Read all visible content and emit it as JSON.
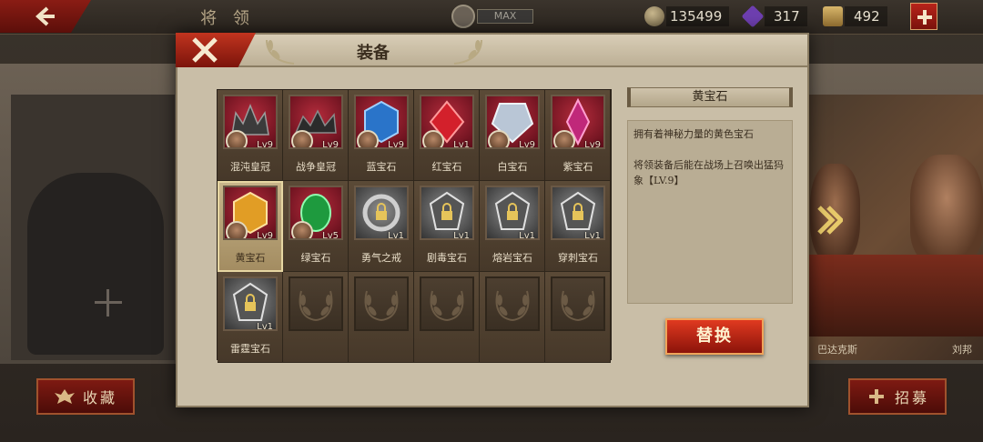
{
  "topbar": {
    "title": "将 领",
    "max_label": "MAX",
    "resources": [
      {
        "icon": "coin-icon",
        "value": "135499"
      },
      {
        "icon": "purple-gem-icon",
        "value": "317"
      },
      {
        "icon": "scroll-icon",
        "value": "492"
      }
    ]
  },
  "background": {
    "hero_names": [
      "巴达克斯",
      "刘邦"
    ],
    "collect_label": "收藏",
    "recruit_label": "招募"
  },
  "modal": {
    "title": "装备",
    "items": [
      {
        "name": "混沌皇冠",
        "level": "Lv9",
        "style": "red",
        "art": "crown-dark-icon",
        "avatar": true
      },
      {
        "name": "战争皇冠",
        "level": "Lv9",
        "style": "red",
        "art": "crown-war-icon",
        "avatar": true
      },
      {
        "name": "蓝宝石",
        "level": "Lv9",
        "style": "red",
        "art": "sapphire-icon",
        "avatar": true
      },
      {
        "name": "红宝石",
        "level": "Lv1",
        "style": "red",
        "art": "ruby-icon",
        "avatar": true
      },
      {
        "name": "白宝石",
        "level": "Lv9",
        "style": "red",
        "art": "diamond-icon",
        "avatar": true
      },
      {
        "name": "紫宝石",
        "level": "Lv9",
        "style": "red",
        "art": "amethyst-icon",
        "avatar": true
      },
      {
        "name": "黄宝石",
        "level": "Lv9",
        "style": "red",
        "art": "topaz-icon",
        "avatar": true,
        "selected": true
      },
      {
        "name": "绿宝石",
        "level": "Lv5",
        "style": "red",
        "art": "emerald-icon",
        "avatar": true
      },
      {
        "name": "勇气之戒",
        "level": "Lv1",
        "style": "grey",
        "art": "locked-ring-icon",
        "avatar": false
      },
      {
        "name": "剧毒宝石",
        "level": "Lv1",
        "style": "grey",
        "art": "locked-gem-icon",
        "avatar": false
      },
      {
        "name": "熔岩宝石",
        "level": "Lv1",
        "style": "grey",
        "art": "locked-gem-icon",
        "avatar": false
      },
      {
        "name": "穿刺宝石",
        "level": "Lv1",
        "style": "grey",
        "art": "locked-gem-icon",
        "avatar": false
      },
      {
        "name": "雷霆宝石",
        "level": "Lv1",
        "style": "grey",
        "art": "locked-gem-icon",
        "avatar": false
      }
    ],
    "empty_slots": 5,
    "detail": {
      "title": "黄宝石",
      "desc1": "拥有着神秘力量的黄色宝石",
      "desc2": "将领装备后能在战场上召唤出猛犸象【LV.9】"
    },
    "replace_label": "替换"
  },
  "colors": {
    "accent_red": "#b8241a",
    "gold": "#e6d6a2",
    "panel": "#c9bea7"
  }
}
